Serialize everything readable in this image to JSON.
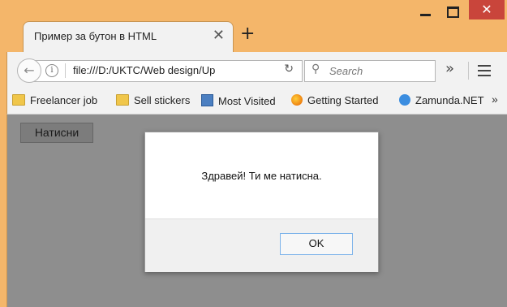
{
  "window": {
    "tab_title": "Пример за бутон в HTML",
    "tab_close": "✕",
    "new_tab": "+",
    "close_glyph": "✕"
  },
  "navbar": {
    "back_glyph": "←",
    "info_glyph": "i",
    "url": "file:///D:/UKTC/Web design/Up",
    "reload_glyph": "↻",
    "search_placeholder": "Search",
    "search_glyph": "⚲",
    "overflow_glyph": "»"
  },
  "bookmarks": {
    "items": [
      {
        "label": "Freelancer job",
        "icon": "folder-icon"
      },
      {
        "label": "Sell stickers",
        "icon": "folder-icon"
      },
      {
        "label": "Most Visited",
        "icon": "most-visited-icon"
      },
      {
        "label": "Getting Started",
        "icon": "firefox-icon"
      },
      {
        "label": "Zamunda.NET",
        "icon": "zamunda-icon"
      }
    ],
    "overflow_glyph": "»"
  },
  "page": {
    "button_label": "Натисни"
  },
  "dialog": {
    "message": "Здравей! Ти ме натисна.",
    "ok_label": "OK"
  }
}
